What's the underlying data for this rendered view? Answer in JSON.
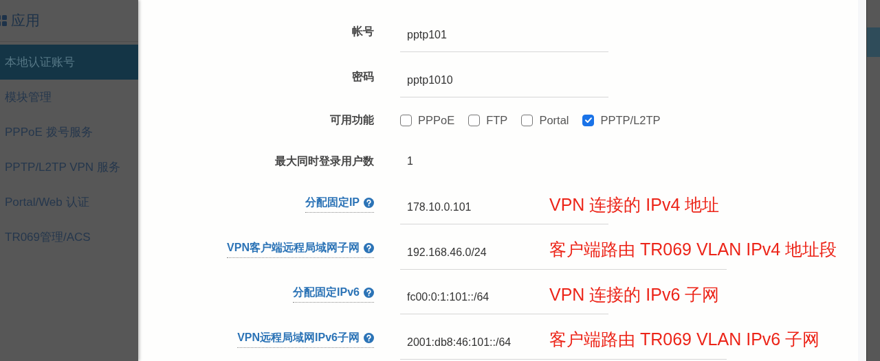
{
  "sidebar": {
    "title": "应用",
    "items": [
      {
        "label": "本地认证账号",
        "selected": true
      },
      {
        "label": "模块管理",
        "selected": false
      },
      {
        "label": "PPPoE 拨号服务",
        "selected": false
      },
      {
        "label": "PPTP/L2TP VPN 服务",
        "selected": false
      },
      {
        "label": "Portal/Web 认证",
        "selected": false
      },
      {
        "label": "TR069管理/ACS",
        "selected": false
      }
    ]
  },
  "form": {
    "rows": [
      {
        "kind": "field",
        "label": "帐号",
        "help": false,
        "value": "pptp101"
      },
      {
        "kind": "field",
        "label": "密码",
        "help": false,
        "value": "pptp1010"
      },
      {
        "kind": "checkboxes",
        "label": "可用功能",
        "help": false,
        "options": [
          {
            "label": "PPPoE",
            "checked": false
          },
          {
            "label": "FTP",
            "checked": false
          },
          {
            "label": "Portal",
            "checked": false
          },
          {
            "label": "PPTP/L2TP",
            "checked": true
          }
        ]
      },
      {
        "kind": "plain",
        "label": "最大同时登录用户数",
        "help": false,
        "value": "1"
      },
      {
        "kind": "field",
        "label": "分配固定IP",
        "help": true,
        "value": "178.10.0.101",
        "annotation": "VPN 连接的 IPv4 地址"
      },
      {
        "kind": "field",
        "label": "VPN客户端远程局域网子网",
        "help": true,
        "value": "192.168.46.0/24",
        "annotation": "客户端路由 TR069 VLAN IPv4 地址段"
      },
      {
        "kind": "field",
        "label": "分配固定IPv6",
        "help": true,
        "value": "fc00:0:1:101::/64",
        "annotation": "VPN 连接的 IPv6 子网"
      },
      {
        "kind": "field",
        "label": "VPN远程局域网IPv6子网",
        "help": true,
        "value": "2001:db8:46:101::/64",
        "annotation": "客户端路由 TR069 VLAN IPv6 子网"
      }
    ]
  }
}
